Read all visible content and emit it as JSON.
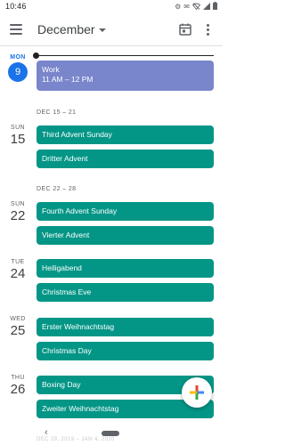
{
  "status_bar": {
    "time": "10:46",
    "icons": [
      "settings-icon",
      "mail-icon",
      "wifi-off-icon",
      "signal-icon",
      "battery-icon"
    ]
  },
  "app_bar": {
    "month": "December",
    "menu_icon": "menu-icon",
    "today_icon": "calendar-today-icon",
    "more_icon": "more-vert-icon"
  },
  "agenda": {
    "days": [
      {
        "dow": "MON",
        "dom": "9",
        "today": true,
        "events": [
          {
            "title": "Work",
            "time": "11 AM – 12 PM",
            "color": "#7986cb"
          }
        ]
      },
      {
        "range": "DEC 15 – 21",
        "dow": "SUN",
        "dom": "15",
        "events": [
          {
            "title": "Third Advent Sunday",
            "color": "#039686"
          },
          {
            "title": "Dritter Advent",
            "color": "#039686"
          }
        ]
      },
      {
        "range": "DEC 22 – 28",
        "dow": "SUN",
        "dom": "22",
        "events": [
          {
            "title": "Fourth Advent Sunday",
            "color": "#039686"
          },
          {
            "title": "Vierter Advent",
            "color": "#039686"
          }
        ]
      },
      {
        "dow": "TUE",
        "dom": "24",
        "events": [
          {
            "title": "Heiligabend",
            "color": "#039686"
          },
          {
            "title": "Christmas Eve",
            "color": "#039686"
          }
        ]
      },
      {
        "dow": "WED",
        "dom": "25",
        "events": [
          {
            "title": "Erster Weihnachtstag",
            "color": "#039686"
          },
          {
            "title": "Christmas Day",
            "color": "#039686"
          }
        ]
      },
      {
        "dow": "THU",
        "dom": "26",
        "events": [
          {
            "title": "Boxing Day",
            "color": "#039686"
          },
          {
            "title": "Zweiter Weihnachtstag",
            "color": "#039686"
          }
        ]
      }
    ],
    "next_range_faded": "DEC 29, 2019 – JAN 4, 2020"
  },
  "fab": {
    "icon": "add-icon"
  },
  "nav_bar": {
    "back_icon": "back-icon",
    "home_icon": "home-pill-icon"
  }
}
